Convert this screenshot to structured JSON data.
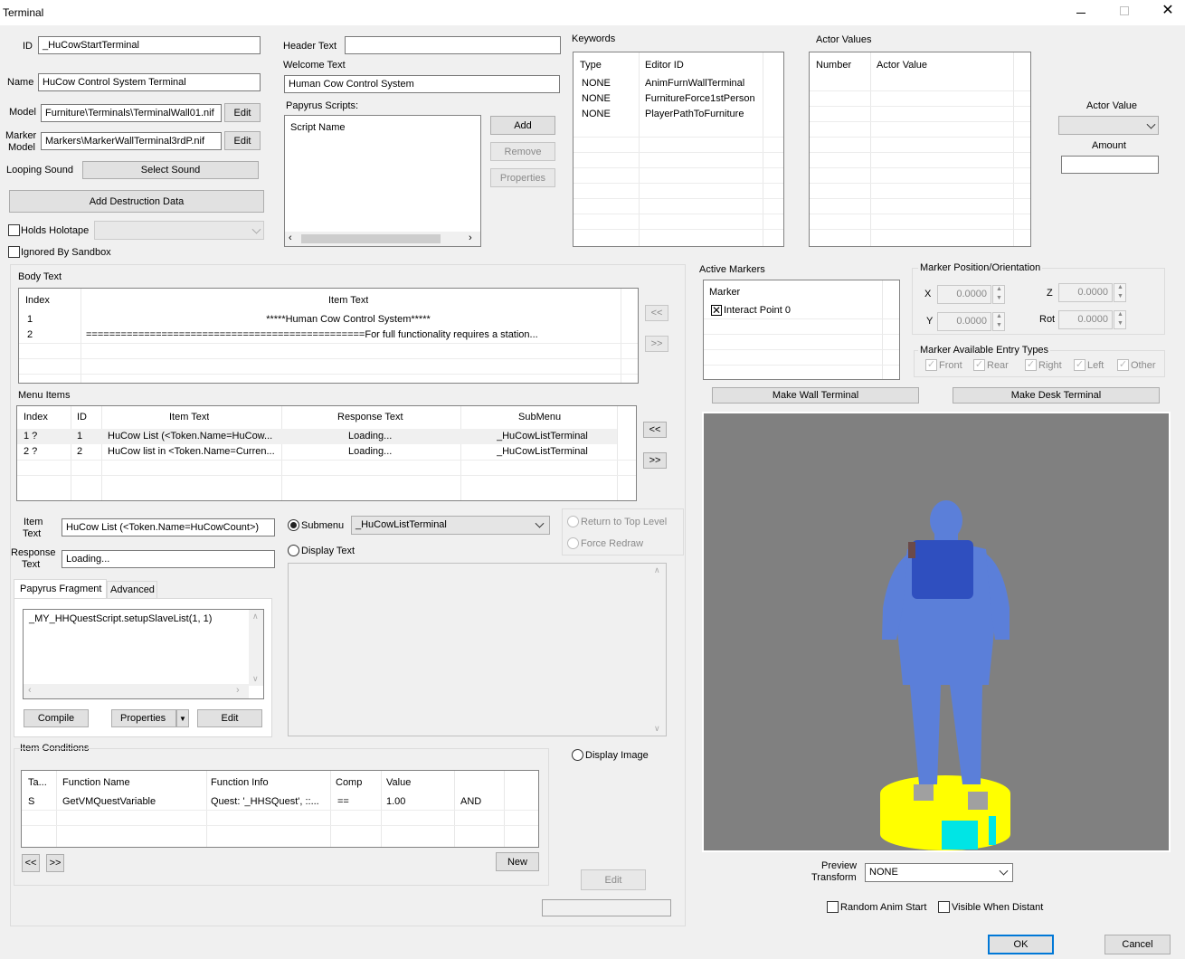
{
  "window": {
    "title": "Terminal"
  },
  "form": {
    "id_label": "ID",
    "id_value": "_HuCowStartTerminal",
    "name_label": "Name",
    "name_value": "HuCow Control System Terminal",
    "model_label": "Model",
    "model_value": "Furniture\\Terminals\\TerminalWall01.nif",
    "marker_model_label1": "Marker",
    "marker_model_label2": "Model",
    "marker_model_value": "Markers\\MarkerWallTerminal3rdP.nif",
    "edit_label": "Edit",
    "looping_sound_label": "Looping Sound",
    "select_sound_label": "Select Sound",
    "add_destruction_label": "Add Destruction Data",
    "holds_holotape_label": "Holds Holotape",
    "ignored_sandbox_label": "Ignored By Sandbox",
    "header_text_label": "Header Text",
    "header_text_value": "",
    "welcome_text_label": "Welcome Text",
    "welcome_text_value": "Human Cow Control System"
  },
  "scripts": {
    "label": "Papyrus Scripts:",
    "col": "Script Name",
    "add": "Add",
    "remove": "Remove",
    "properties": "Properties"
  },
  "keywords": {
    "label": "Keywords",
    "cols": [
      "Type",
      "Editor ID"
    ],
    "rows": [
      {
        "type": "NONE",
        "id": "AnimFurnWallTerminal"
      },
      {
        "type": "NONE",
        "id": "FurnitureForce1stPerson"
      },
      {
        "type": "NONE",
        "id": "PlayerPathToFurniture"
      }
    ]
  },
  "actor_values": {
    "label": "Actor Values",
    "cols": [
      "Number",
      "Actor Value"
    ],
    "av_label": "Actor Value",
    "amount_label": "Amount"
  },
  "body_text": {
    "label": "Body Text",
    "cols": [
      "Index",
      "Item Text"
    ],
    "rows": [
      {
        "index": "1",
        "text": "*****Human Cow Control System*****"
      },
      {
        "index": "2",
        "text": "================================================For full functionality requires a station..."
      }
    ],
    "up": "<<",
    "down": ">>"
  },
  "menu_items": {
    "label": "Menu Items",
    "cols": [
      "Index",
      "ID",
      "Item Text",
      "Response Text",
      "SubMenu"
    ],
    "rows": [
      {
        "index": "1 ?",
        "id": "1",
        "text": "HuCow List (<Token.Name=HuCow...",
        "resp": "Loading...",
        "sub": "_HuCowListTerminal"
      },
      {
        "index": "2 ?",
        "id": "2",
        "text": "HuCow list in <Token.Name=Curren...",
        "resp": "Loading...",
        "sub": "_HuCowListTerminal"
      }
    ],
    "up": "<<",
    "down": ">>"
  },
  "item": {
    "item_text_label1": "Item",
    "item_text_label2": "Text",
    "item_text_value": "HuCow List (<Token.Name=HuCowCount>)",
    "response_label1": "Response",
    "response_label2": "Text",
    "response_value": "Loading...",
    "submenu_label": "Submenu",
    "submenu_value": "_HuCowListTerminal",
    "display_text_label": "Display Text",
    "return_top_label": "Return to Top Level",
    "force_redraw_label": "Force Redraw",
    "display_image_label": "Display Image"
  },
  "fragment": {
    "tab1": "Papyrus Fragment",
    "tab2": "Advanced",
    "code": "_MY_HHQuestScript.setupSlaveList(1, 1)",
    "compile": "Compile",
    "properties": "Properties",
    "edit": "Edit"
  },
  "conditions": {
    "label": "Item Conditions",
    "cols": [
      "Ta...",
      "Function Name",
      "Function Info",
      "Comp",
      "Value",
      ""
    ],
    "rows": [
      {
        "ta": "S",
        "fn": "GetVMQuestVariable",
        "info": "Quest: '_HHSQuest', ::...",
        "comp": "==",
        "value": "1.00",
        "op": "AND"
      }
    ],
    "prev": "<<",
    "next": ">>",
    "new": "New",
    "edit": "Edit"
  },
  "markers": {
    "active_label": "Active Markers",
    "col": "Marker",
    "item": "Interact Point 0",
    "pos_label": "Marker Position/Orientation",
    "x_label": "X",
    "x_value": "0.0000",
    "y_label": "Y",
    "y_value": "0.0000",
    "z_label": "Z",
    "z_value": "0.0000",
    "rot_label": "Rot",
    "rot_value": "0.0000",
    "entry_label": "Marker Available Entry Types",
    "entries": [
      "Front",
      "Rear",
      "Right",
      "Left",
      "Other"
    ],
    "wall": "Make Wall Terminal",
    "desk": "Make Desk Terminal"
  },
  "preview": {
    "transform_label1": "Preview",
    "transform_label2": "Transform",
    "transform_value": "NONE",
    "random_anim": "Random Anim Start",
    "visible_distant": "Visible When Distant",
    "bg_color": "#808080",
    "figure_color": "#5b7fd9",
    "base_color": "#ffff00"
  },
  "footer": {
    "ok": "OK",
    "cancel": "Cancel"
  }
}
